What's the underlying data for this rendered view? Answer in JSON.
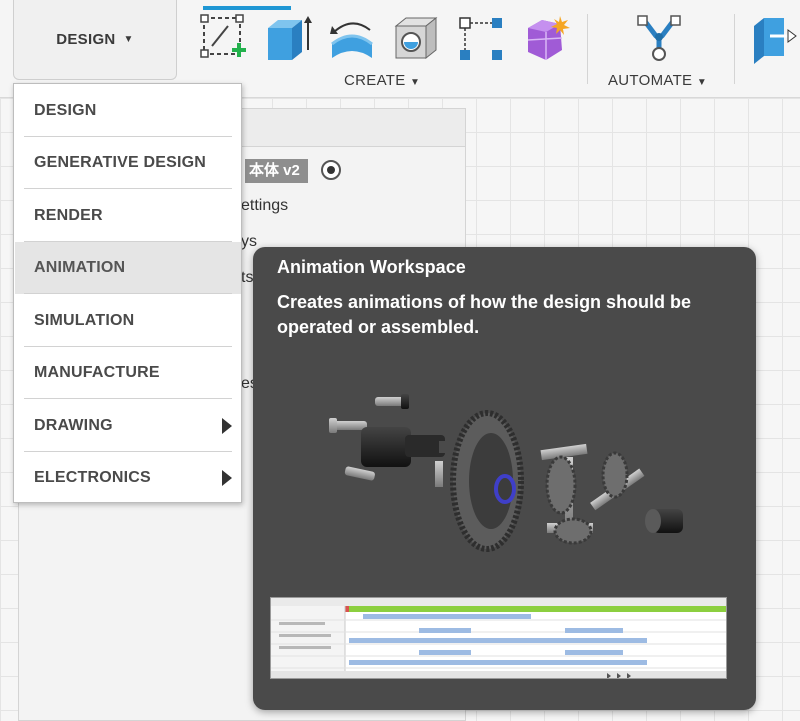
{
  "toolbar": {
    "workspace_label": "DESIGN",
    "create_label": "CREATE",
    "automate_label": "AUTOMATE",
    "accent_color": "#1f97d4"
  },
  "browser": {
    "doc_name": "本体 v2",
    "partial_rows": [
      "ettings",
      "ys",
      "ts",
      "es"
    ]
  },
  "menu": {
    "items": [
      {
        "label": "DESIGN"
      },
      {
        "label": "GENERATIVE DESIGN"
      },
      {
        "label": "RENDER"
      },
      {
        "label": "ANIMATION"
      },
      {
        "label": "SIMULATION"
      },
      {
        "label": "MANUFACTURE"
      },
      {
        "label": "DRAWING"
      },
      {
        "label": "ELECTRONICS"
      }
    ],
    "active_index": 3
  },
  "tooltip": {
    "title": "Animation Workspace",
    "description": "Creates animations of how the design should be operated or assembled."
  }
}
